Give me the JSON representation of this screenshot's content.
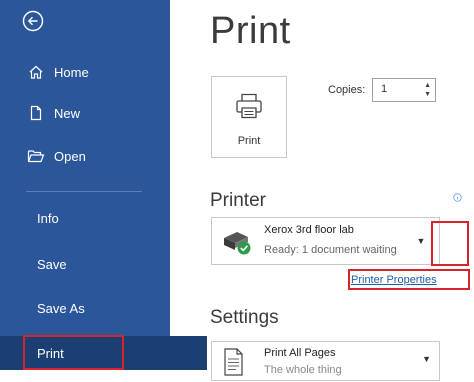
{
  "sidebar": {
    "items": [
      {
        "label": "Home",
        "icon": "home-icon"
      },
      {
        "label": "New",
        "icon": "new-document-icon"
      },
      {
        "label": "Open",
        "icon": "folder-open-icon"
      },
      {
        "label": "Info"
      },
      {
        "label": "Save"
      },
      {
        "label": "Save As"
      },
      {
        "label": "Print",
        "active": true
      }
    ]
  },
  "main": {
    "title": "Print",
    "print_button_label": "Print",
    "copies_label": "Copies:",
    "copies_value": "1",
    "printer_heading": "Printer",
    "printer_name": "Xerox 3rd floor lab",
    "printer_status": "Ready: 1 document waiting",
    "printer_properties_link": "Printer Properties",
    "settings_heading": "Settings",
    "settings_option": "Print All Pages",
    "settings_option_sub": "The whole thing"
  },
  "colors": {
    "sidebar_bg": "#2b579a",
    "active_item_bg": "#1b3f73",
    "highlight_border": "#d8232a",
    "link": "#1e5fa8"
  }
}
